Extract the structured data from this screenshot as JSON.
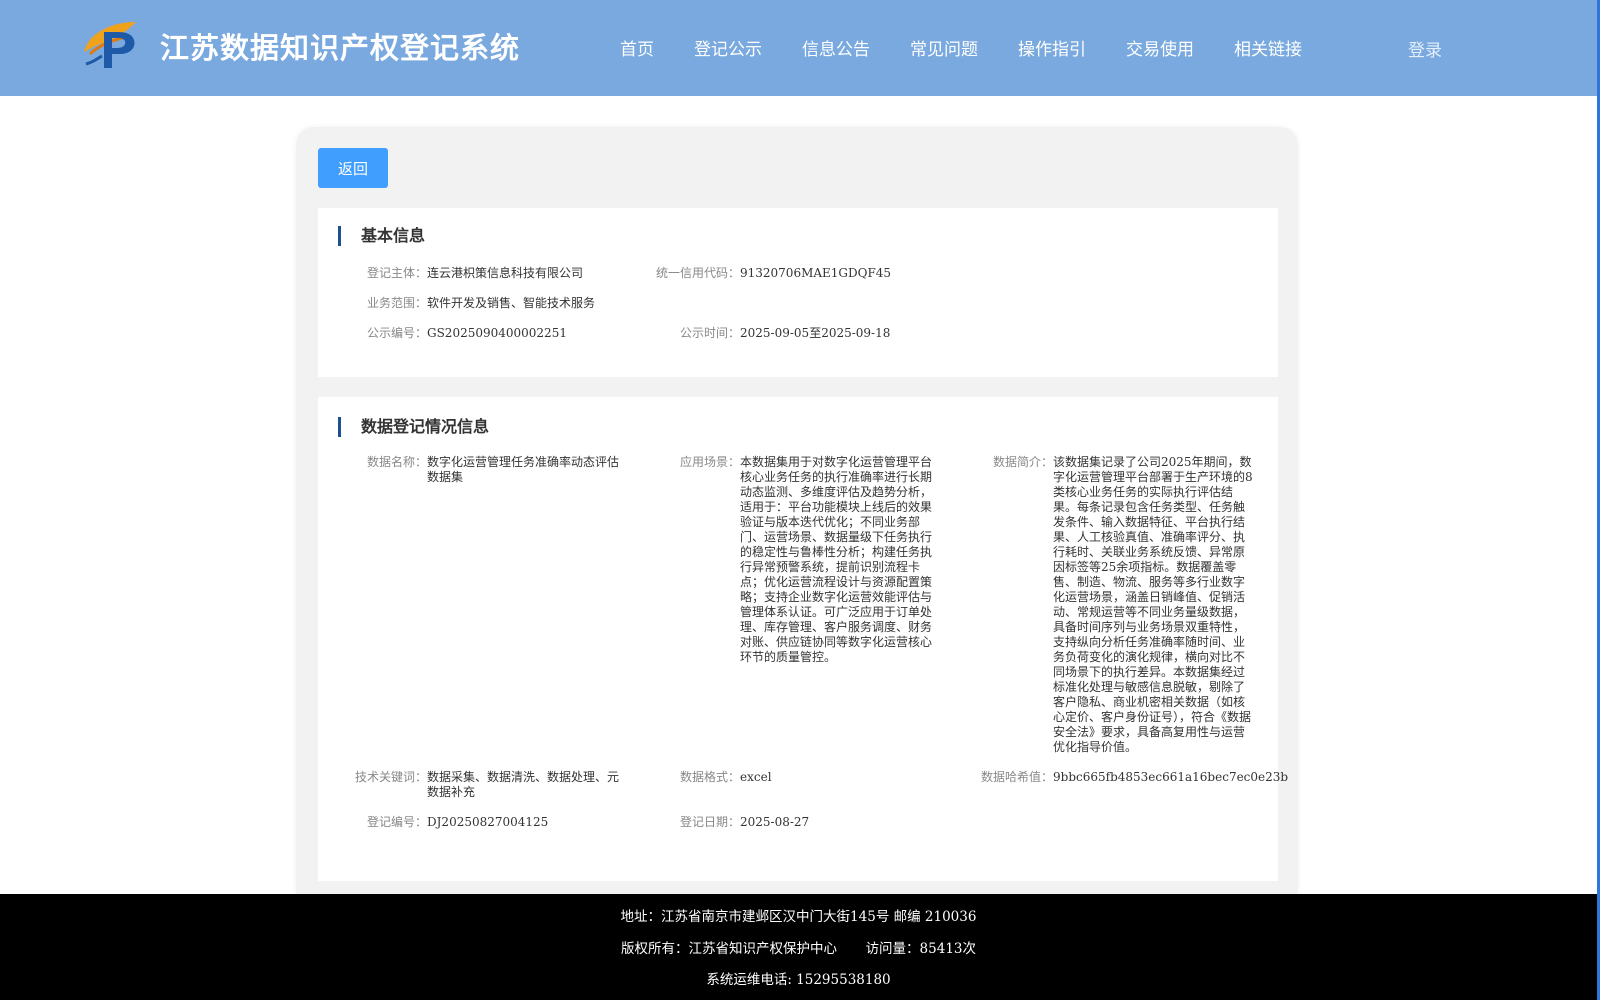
{
  "header": {
    "site_title": "江苏数据知识产权登记系统",
    "nav_items": [
      "首页",
      "登记公示",
      "信息公告",
      "常见问题",
      "操作指引",
      "交易使用",
      "相关链接"
    ],
    "login_label": "登录"
  },
  "back_label": "返回",
  "basic_info": {
    "title": "基本信息",
    "subject_label": "登记主体：",
    "subject": "连云港枳策信息科技有限公司",
    "credit_code_label": "统一信用代码：",
    "credit_code": "91320706MAE1GDQF45",
    "business_scope_label": "业务范围：",
    "business_scope": "软件开发及销售、智能技术服务",
    "publicity_no_label": "公示编号：",
    "publicity_no": "GS2025090400002251",
    "publicity_time_label": "公示时间：",
    "publicity_time": "2025-09-05至2025-09-18"
  },
  "data_info": {
    "title": "数据登记情况信息",
    "data_name_label": "数据名称：",
    "data_name": "数字化运营管理任务准确率动态评估数据集",
    "scenario_label": "应用场景：",
    "scenario": "本数据集用于对数字化运营管理平台核心业务任务的执行准确率进行长期动态监测、多维度评估及趋势分析，适用于：平台功能模块上线后的效果验证与版本迭代优化；不同业务部门、运营场景、数据量级下任务执行的稳定性与鲁棒性分析；构建任务执行异常预警系统，提前识别流程卡点；优化运营流程设计与资源配置策略；支持企业数字化运营效能评估与管理体系认证。可广泛应用于订单处理、库存管理、客户服务调度、财务对账、供应链协同等数字化运营核心环节的质量管控。",
    "intro_label": "数据简介：",
    "intro": "该数据集记录了公司2025年期间，数字化运营管理平台部署于生产环境的8类核心业务任务的实际执行评估结果。每条记录包含任务类型、任务触发条件、输入数据特征、平台执行结果、人工核验真值、准确率评分、执行耗时、关联业务系统反馈、异常原因标签等25余项指标。数据覆盖零售、制造、物流、服务等多行业数字化运营场景，涵盖日销峰值、促销活动、常规运营等不同业务量级数据，具备时间序列与业务场景双重特性，支持纵向分析任务准确率随时间、业务负荷变化的演化规律，横向对比不同场景下的执行差异。本数据集经过标准化处理与敏感信息脱敏，剔除了客户隐私、商业机密相关数据（如核心定价、客户身份证号），符合《数据安全法》要求，具备高复用性与运营优化指导价值。",
    "keywords_label": "技术关键词：",
    "keywords": "数据采集、数据清洗、数据处理、元数据补充",
    "format_label": "数据格式：",
    "format": "excel",
    "hash_label": "数据哈希值：",
    "hash": "9bbc665fb4853ec661a16bec7ec0e23b",
    "reg_no_label": "登记编号：",
    "reg_no": "DJ20250827004125",
    "reg_date_label": "登记日期：",
    "reg_date": "2025-08-27"
  },
  "footer": {
    "address": "地址：江苏省南京市建邺区汉中门大街145号 邮编 210036",
    "copyright": "版权所有：江苏省知识产权保护中心",
    "visits": "访问量：85413次",
    "phone": "系统运维电话: 15295538180"
  },
  "colors": {
    "header_bg": "#79a9de",
    "primary_button": "#409eff",
    "section_bar": "#1d4f91",
    "footer_bg": "#000000"
  },
  "icons": {
    "logo": "ip-logo-icon"
  }
}
